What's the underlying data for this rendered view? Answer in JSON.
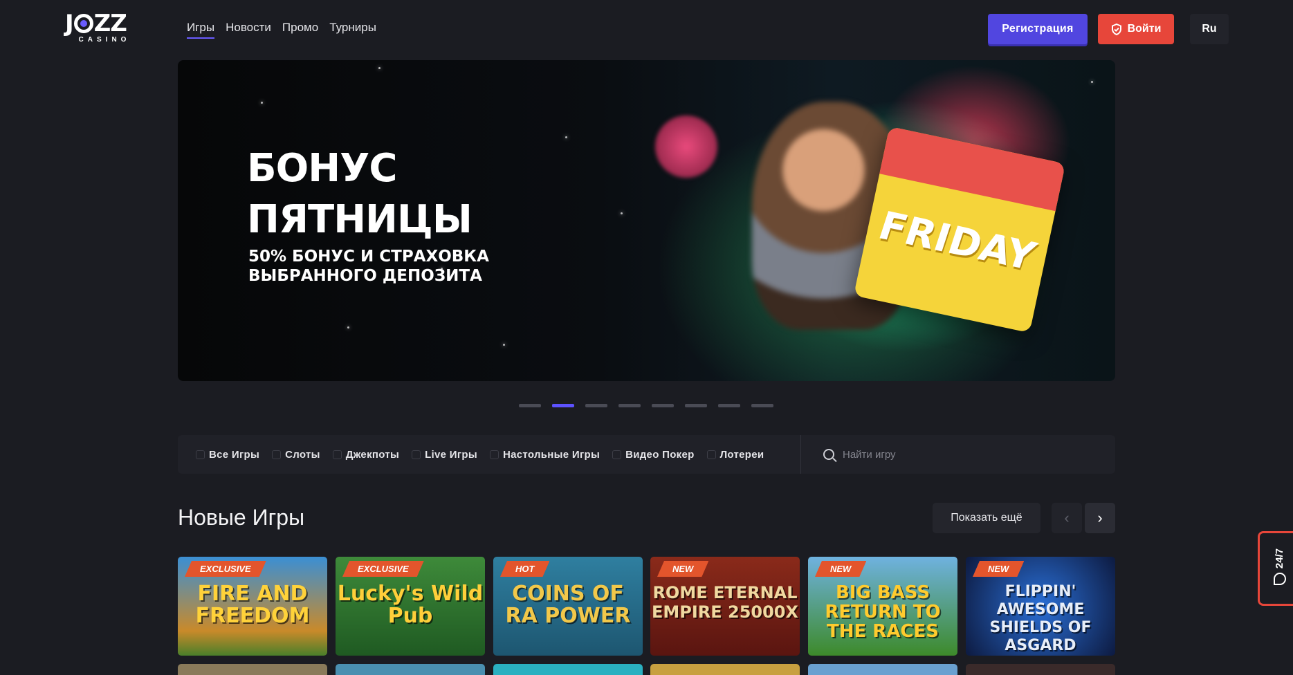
{
  "header": {
    "logo_text": "JOZZ",
    "logo_sub": "CASINO",
    "nav": [
      {
        "label": "Игры",
        "active": true
      },
      {
        "label": "Новости",
        "active": false
      },
      {
        "label": "Промо",
        "active": false
      },
      {
        "label": "Турниры",
        "active": false
      }
    ],
    "register_label": "Регистрация",
    "login_label": "Войти",
    "lang_label": "Ru"
  },
  "banner": {
    "title_line1": "БОНУС",
    "title_line2": "ПЯТНИЦЫ",
    "subtitle_line1": "50% БОНУС И СТРАХОВКА",
    "subtitle_line2": "ВЫБРАННОГО ДЕПОЗИТА",
    "art_text": "FRIDAY",
    "slides_total": 8,
    "active_slide": 2
  },
  "categories": [
    {
      "label": "Все Игры",
      "icon": "all-games-icon"
    },
    {
      "label": "Слоты",
      "icon": "slots-icon"
    },
    {
      "label": "Джекпоты",
      "icon": "jackpot-icon"
    },
    {
      "label": "Live Игры",
      "icon": "live-games-icon"
    },
    {
      "label": "Настольные Игры",
      "icon": "table-games-icon"
    },
    {
      "label": "Видео Покер",
      "icon": "video-poker-icon"
    },
    {
      "label": "Лотереи",
      "icon": "lottery-icon"
    }
  ],
  "search": {
    "placeholder": "Найти игру"
  },
  "section": {
    "title": "Новые Игры",
    "more_label": "Показать ещё"
  },
  "games": [
    {
      "badge": "EXCLUSIVE",
      "name": "FIRE AND FREEDOM",
      "bg": "#2a77b8"
    },
    {
      "badge": "EXCLUSIVE",
      "name": "Lucky's Wild Pub",
      "bg": "#2f7a2f"
    },
    {
      "badge": "HOT",
      "name": "COINS OF RA POWER",
      "bg": "#2a6f8c"
    },
    {
      "badge": "NEW",
      "name": "ROME ETERNAL EMPIRE 25000X",
      "bg": "#7a2a1c"
    },
    {
      "badge": "NEW",
      "name": "BIG BASS RETURN TO THE RACES",
      "bg": "#3f7f2a"
    },
    {
      "badge": "NEW",
      "name": "FLIPPIN' AWESOME SHIELDS OF ASGARD",
      "bg": "#1f3c7a"
    }
  ],
  "support": {
    "label": "24/7"
  },
  "colors": {
    "accent": "#5146e0",
    "danger": "#e7463a",
    "bg": "#1b1c22"
  }
}
